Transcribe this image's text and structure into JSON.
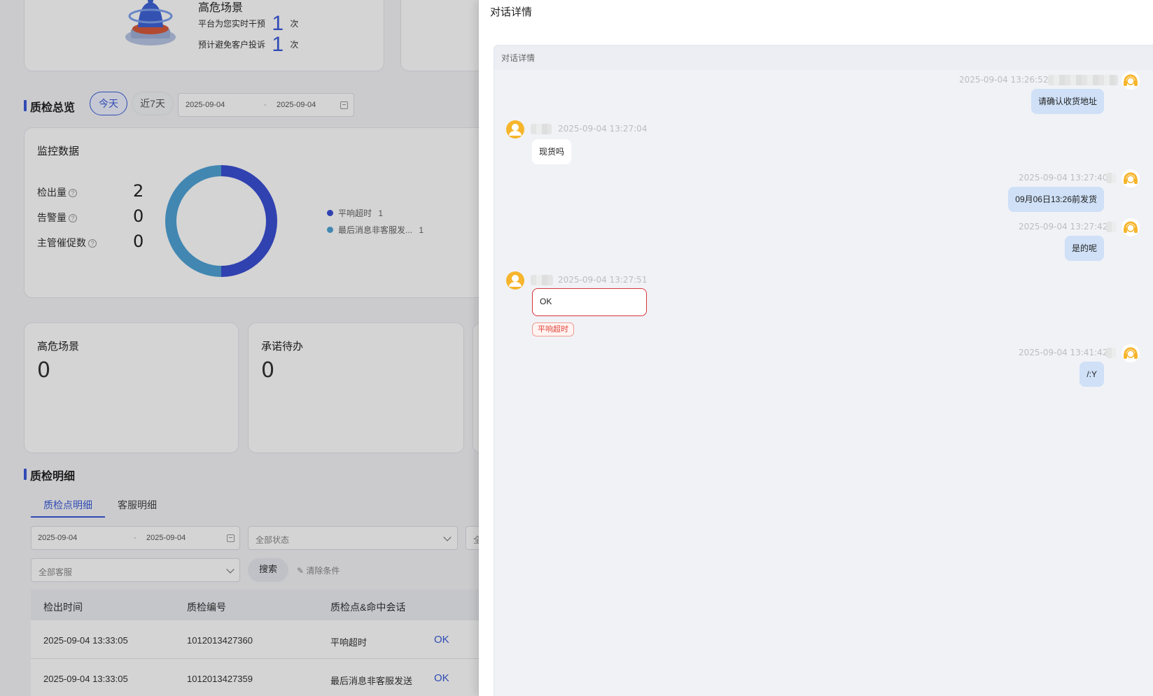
{
  "risk_card": {
    "title": "高危场景",
    "line1_label": "平台为您实时干预",
    "line1_value": "1",
    "line1_unit": "次",
    "line2_label": "预计避免客户投诉",
    "line2_value": "1",
    "line2_unit": "次"
  },
  "overview": {
    "title": "质检总览",
    "today_label": "今天",
    "last7_label": "近7天",
    "date_start": "2025-09-04",
    "date_sep": "-",
    "date_end": "2025-09-04"
  },
  "monitor": {
    "title": "监控数据",
    "metrics": [
      {
        "label": "检出量",
        "value": "2"
      },
      {
        "label": "告警量",
        "value": "0"
      },
      {
        "label": "主管催促数",
        "value": "0"
      }
    ]
  },
  "chart_data": {
    "type": "pie",
    "donut": true,
    "categories": [
      "平响超时",
      "最后消息非客服发..."
    ],
    "values": [
      1,
      1
    ],
    "colors": [
      "#3a4fd4",
      "#4fa3d6"
    ],
    "legend_position": "right"
  },
  "cards": [
    {
      "title": "高危场景",
      "value": "0"
    },
    {
      "title": "承诺待办",
      "value": "0"
    }
  ],
  "detail": {
    "title": "质检明细",
    "tabs": [
      "质检点明细",
      "客服明细"
    ],
    "active_tab": 0,
    "filter": {
      "date_start": "2025-09-04",
      "date_sep": "-",
      "date_end": "2025-09-04",
      "status_placeholder": "全部状态",
      "cut_placeholder": "全",
      "agent_placeholder": "全部客服",
      "search_label": "搜索",
      "clear_label": "清除条件"
    },
    "columns": [
      "检出时间",
      "质检编号",
      "质检点&命中会话"
    ],
    "rows": [
      {
        "time": "2025-09-04 13:33:05",
        "id": "1012013427360",
        "point": "平响超时",
        "hit": "OK"
      },
      {
        "time": "2025-09-04 13:33:05",
        "id": "1012013427359",
        "point": "最后消息非客服发送",
        "hit": "OK"
      }
    ]
  },
  "drawer": {
    "title": "对话详情",
    "panel_title": "对话详情",
    "messages": [
      {
        "role": "agent",
        "time": "2025-09-04 13:26:52",
        "text": "请确认收货地址"
      },
      {
        "role": "customer",
        "time": "2025-09-04 13:27:04",
        "text": "现货吗"
      },
      {
        "role": "agent",
        "time": "2025-09-04 13:27:40",
        "text": "09月06日13:26前发货"
      },
      {
        "role": "agent",
        "time": "2025-09-04 13:27:42",
        "text": "是的呢"
      },
      {
        "role": "customer",
        "time": "2025-09-04 13:27:51",
        "text": "OK",
        "flag": "平响超时"
      },
      {
        "role": "agent",
        "time": "2025-09-04 13:41:42",
        "text": "/:Y"
      }
    ]
  },
  "colors": {
    "accent": "#3a5bd9",
    "agent_bubble": "#cfe0f7",
    "avatar": "#f7b52c",
    "alert": "#d9363e"
  }
}
